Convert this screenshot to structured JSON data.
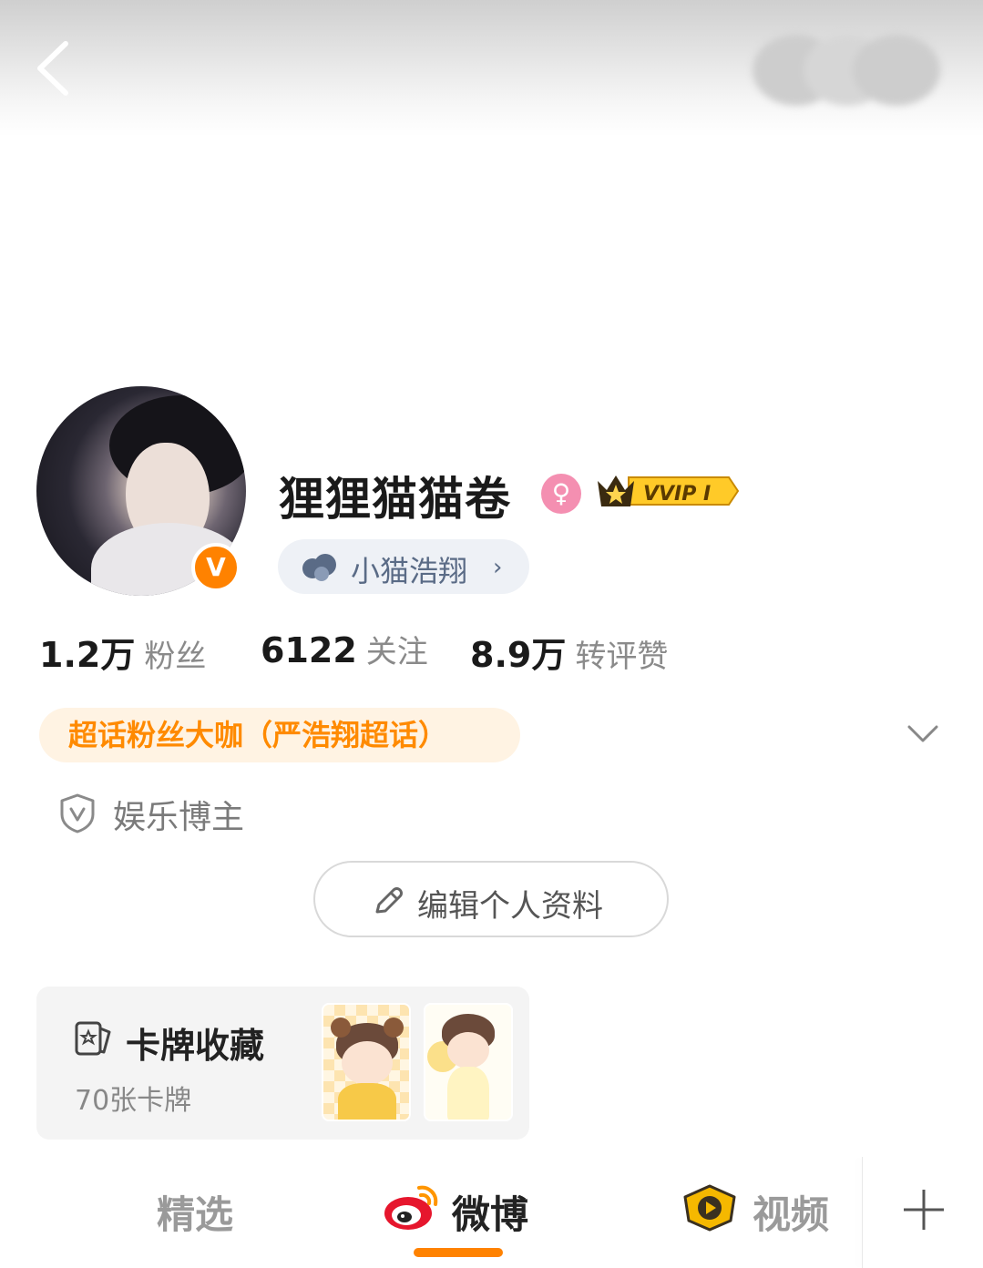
{
  "profile": {
    "username": "狸狸猫猫卷",
    "vip_label": "VVIP I",
    "verified_mark": "V",
    "super_topic_chip": "小猫浩翔",
    "fan_tag": "超话粉丝大咖（严浩翔超话）",
    "role": "娱乐博主",
    "edit_button": "编辑个人资料"
  },
  "stats": [
    {
      "value": "1.2万",
      "label": "粉丝"
    },
    {
      "value": "6122",
      "label": "关注"
    },
    {
      "value": "8.9万",
      "label": "转评赞"
    }
  ],
  "cards": {
    "title": "卡牌收藏",
    "count": "70张卡牌"
  },
  "tabs": [
    {
      "label": "精选",
      "active": false
    },
    {
      "label": "微博",
      "active": true
    },
    {
      "label": "视频",
      "active": false
    }
  ],
  "colors": {
    "accent": "#ff8200",
    "fan_tag_bg": "#fff3e3",
    "chip_bg": "#eef1f6",
    "vip_gold": "#ffc107"
  },
  "icons": {
    "back": "chevron-left-icon",
    "gender": "female-icon",
    "expand": "chevron-down-icon",
    "role": "shield-v-icon",
    "edit": "pencil-icon",
    "cards": "card-icon",
    "add": "plus-icon"
  }
}
